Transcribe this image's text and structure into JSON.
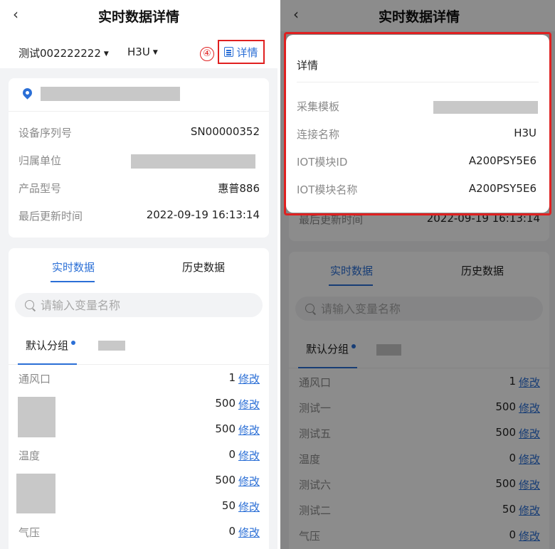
{
  "nav": {
    "back_glyph": "‹",
    "title": "实时数据详情"
  },
  "selectors": {
    "device": "测试002222222",
    "connection": "H3U",
    "caret": "▼"
  },
  "step_badge": "④",
  "detail_link": {
    "label": "详情",
    "icon": "list-icon"
  },
  "info": {
    "serial": {
      "label": "设备序列号",
      "value": "SN00000352"
    },
    "owner": {
      "label": "归属单位"
    },
    "model": {
      "label": "产品型号",
      "value": "惠普886"
    },
    "updated": {
      "label": "最后更新时间",
      "value": "2022-09-19 16:13:14"
    }
  },
  "tabs": {
    "realtime": "实时数据",
    "history": "历史数据"
  },
  "search": {
    "placeholder": "请输入变量名称"
  },
  "group": {
    "default": "默认分组"
  },
  "edit_label": "修改",
  "left_rows": [
    {
      "name": "通风口",
      "value": "1"
    },
    {
      "name": "",
      "value": "500"
    },
    {
      "name": "",
      "value": "500"
    },
    {
      "name": "温度",
      "value": "0"
    },
    {
      "name": "",
      "value": "500"
    },
    {
      "name": "",
      "value": "50"
    },
    {
      "name": "气压",
      "value": "0"
    }
  ],
  "right_rows": [
    {
      "name": "通风口",
      "value": "1"
    },
    {
      "name": "测试一",
      "value": "500"
    },
    {
      "name": "测试五",
      "value": "500"
    },
    {
      "name": "温度",
      "value": "0"
    },
    {
      "name": "测试六",
      "value": "500"
    },
    {
      "name": "测试二",
      "value": "50"
    },
    {
      "name": "气压",
      "value": "0"
    }
  ],
  "popup": {
    "title": "详情",
    "rows": [
      {
        "label": "采集模板",
        "value": ""
      },
      {
        "label": "连接名称",
        "value": "H3U"
      },
      {
        "label": "IOT模块ID",
        "value": "A200PSY5E6"
      },
      {
        "label": "IOT模块名称",
        "value": "A200PSY5E6"
      }
    ]
  },
  "colors": {
    "accent": "#2b6fd6",
    "highlight": "#e02020"
  }
}
